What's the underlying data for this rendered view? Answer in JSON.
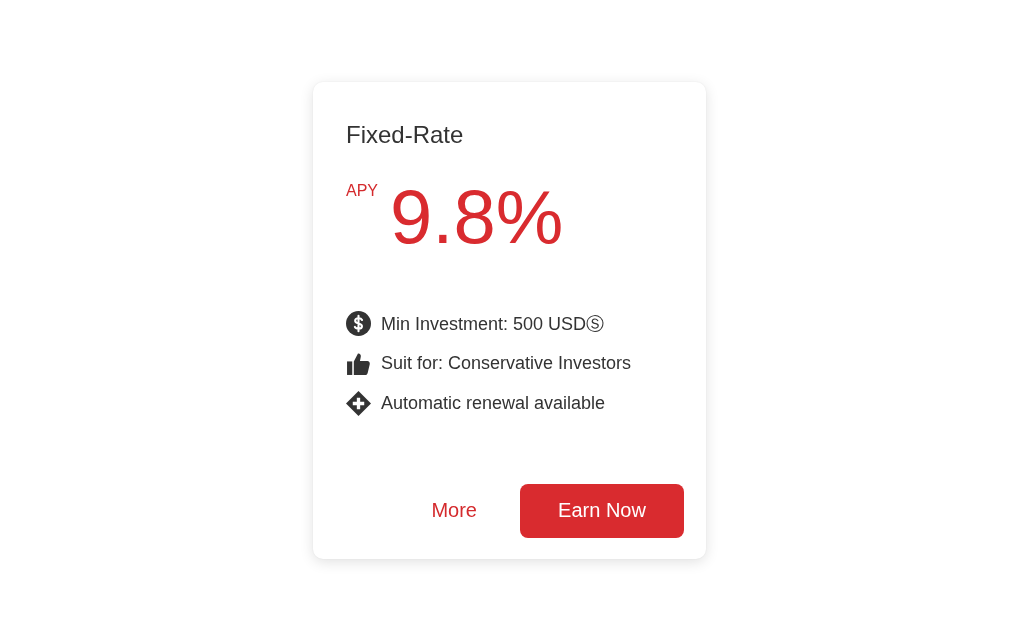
{
  "card": {
    "title": "Fixed-Rate",
    "rate": {
      "label": "APY",
      "value": "9.8%"
    },
    "features": [
      {
        "kind": "dollar",
        "text": "Min Investment: 500 USDⓈ"
      },
      {
        "kind": "thumbs",
        "text": "Suit for: Conservative Investors"
      },
      {
        "kind": "renew",
        "text": "Automatic renewal available"
      }
    ],
    "actions": [
      {
        "kind": "link",
        "label": "More"
      },
      {
        "kind": "primary",
        "label": "Earn Now"
      }
    ]
  }
}
